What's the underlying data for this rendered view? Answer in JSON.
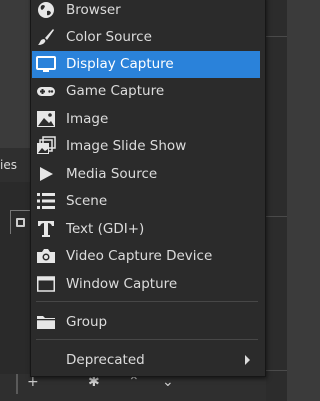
{
  "background": {
    "tab_label": "ies"
  },
  "menu": {
    "items": [
      {
        "label": "Browser",
        "icon": "globe-icon"
      },
      {
        "label": "Color Source",
        "icon": "paintbrush-icon"
      },
      {
        "label": "Display Capture",
        "icon": "monitor-icon",
        "highlighted": true
      },
      {
        "label": "Game Capture",
        "icon": "gamepad-icon"
      },
      {
        "label": "Image",
        "icon": "image-icon"
      },
      {
        "label": "Image Slide Show",
        "icon": "slideshow-icon"
      },
      {
        "label": "Media Source",
        "icon": "play-icon"
      },
      {
        "label": "Scene",
        "icon": "list-icon"
      },
      {
        "label": "Text (GDI+)",
        "icon": "text-icon"
      },
      {
        "label": "Video Capture Device",
        "icon": "camera-icon"
      },
      {
        "label": "Window Capture",
        "icon": "window-icon"
      }
    ],
    "group_label": "Group",
    "deprecated_label": "Deprecated"
  },
  "colors": {
    "menu_bg": "#2b2b2b",
    "highlight": "#2a82da",
    "text": "#dcdcdc"
  }
}
